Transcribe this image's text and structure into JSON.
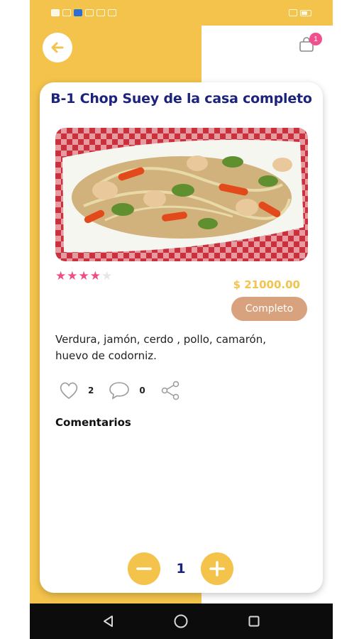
{
  "status_bar": {
    "left_icons": [
      "signal-icon",
      "wifi-icon",
      "shield-icon",
      "whatsapp-icon",
      "mail-icon",
      "gallery-icon"
    ],
    "right_icons": [
      "alarm-icon",
      "battery-icon"
    ]
  },
  "header": {
    "back_icon": "arrow-left-icon",
    "cart_icon": "shopping-bag-icon",
    "cart_count": "1"
  },
  "product": {
    "title": "B-1 Chop Suey de la casa completo",
    "image_alt": "chop-suey-dish-photo",
    "rating": 4,
    "rating_max": 5,
    "price": "$ 21000.00",
    "type": "Completo",
    "description": "Verdura, jamón, cerdo , pollo, camarón, huevo de codorniz."
  },
  "social": {
    "likes": "2",
    "comments": "0",
    "share_icon": "share-icon"
  },
  "comments": {
    "heading": "Comentarios"
  },
  "quantity": {
    "value": "1"
  },
  "navigation": {
    "buttons": [
      "back-triangle-icon",
      "home-circle-icon",
      "recents-square-icon"
    ]
  },
  "colors": {
    "accent_yellow": "#f3c34b",
    "title_navy": "#1b237d",
    "star_pink": "#ec4f85",
    "badge_brown": "#d9a27f",
    "cart_badge_pink": "#f0508e"
  }
}
